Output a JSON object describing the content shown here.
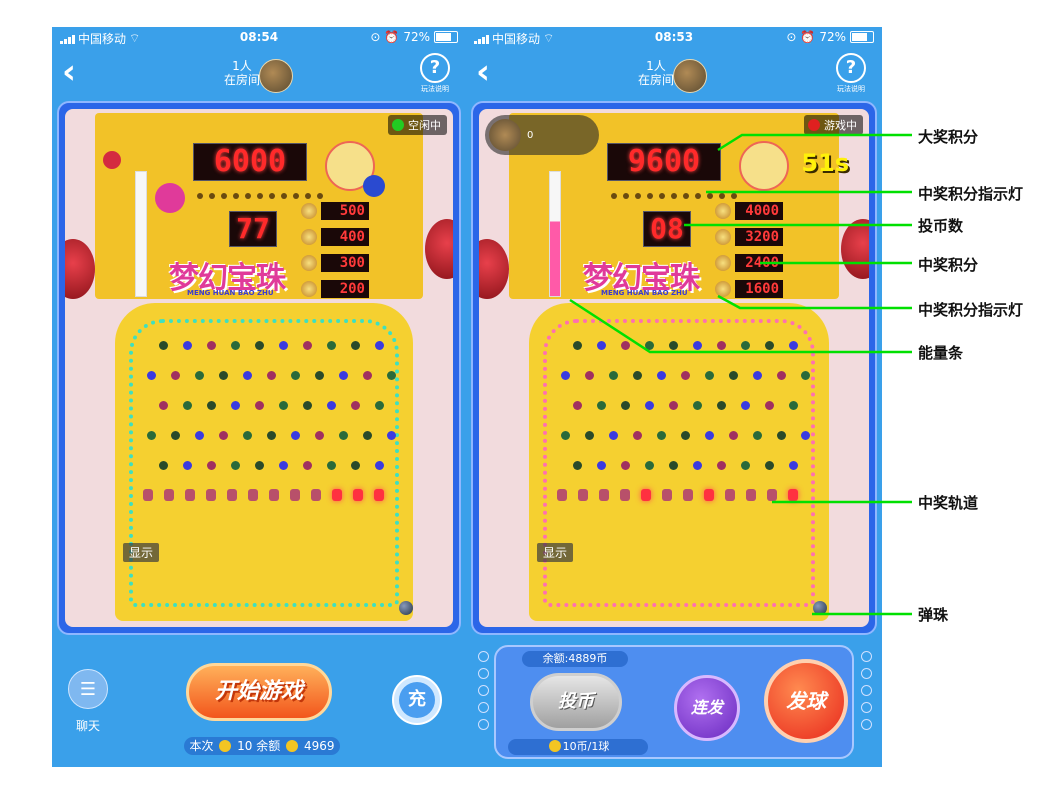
{
  "status_bar": {
    "carrier": "中国移动",
    "battery": "72%",
    "battery_level": 0.72
  },
  "left": {
    "time": "08:54",
    "room_count": "1人",
    "room_label": "在房间",
    "help_label": "玩法说明",
    "status": "空闲中",
    "status_color": "#22cc22",
    "jackpot": "6000",
    "coins_inserted": "77",
    "prize_scores": [
      "500",
      "400",
      "300",
      "200"
    ],
    "display_label": "显示",
    "chat_label": "聊天",
    "start_button": "开始游戏",
    "charge_label": "充",
    "balance": {
      "this_label": "本次",
      "this_value": "10",
      "remaining_label": "余额",
      "remaining_value": "4969"
    }
  },
  "right": {
    "time": "08:53",
    "room_count": "1人",
    "room_label": "在房间",
    "help_label": "玩法说明",
    "status": "游戏中",
    "status_color": "#e02020",
    "player_count": "0",
    "timer": "51s",
    "jackpot": "9600",
    "coins_inserted": "08",
    "prize_scores": [
      "4000",
      "3200",
      "2400",
      "1600"
    ],
    "display_label": "显示",
    "panel_balance": "余额:4889币",
    "coin_button": "投币",
    "price": "10币/1球",
    "auto_button": "连发",
    "shoot_button": "发球"
  },
  "annotations": {
    "jackpot_score": "大奖积分",
    "prize_indicator_1": "中奖积分指示灯",
    "coin_count": "投币数",
    "prize_score": "中奖积分",
    "prize_indicator_2": "中奖积分指示灯",
    "energy_bar": "能量条",
    "prize_track": "中奖轨道",
    "ball": "弹珠"
  }
}
